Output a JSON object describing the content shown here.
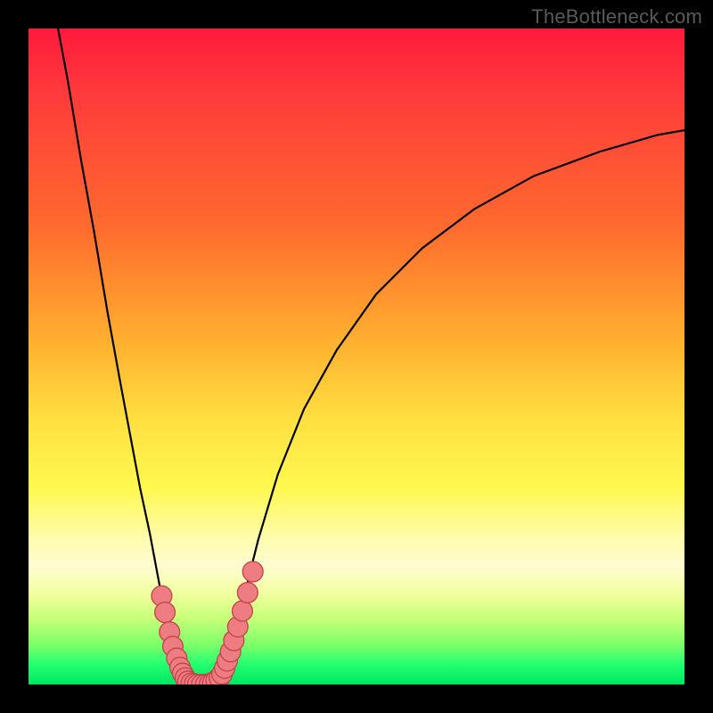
{
  "watermark": "TheBottleneck.com",
  "colors": {
    "curve_stroke": "#000000",
    "marker_fill": "#ee7d81",
    "marker_stroke": "#c1444b",
    "background_black": "#000000"
  },
  "chart_data": {
    "type": "line",
    "title": "",
    "xlabel": "",
    "ylabel": "",
    "xlim": [
      0,
      100
    ],
    "ylim": [
      0,
      100
    ],
    "grid": false,
    "series": [
      {
        "name": "left-branch",
        "x": [
          4.5,
          6.0,
          8.0,
          10.0,
          12.0,
          14.0,
          15.5,
          17.0,
          18.5,
          20.0,
          21.0,
          22.0,
          22.8,
          23.6,
          24.3
        ],
        "y": [
          100,
          92,
          80,
          69,
          57,
          46,
          38,
          30,
          23,
          15,
          10,
          6,
          3.5,
          1.2,
          0.0
        ]
      },
      {
        "name": "valley-floor",
        "x": [
          24.3,
          25.0,
          26.0,
          27.0,
          28.0,
          28.8
        ],
        "y": [
          0.0,
          0.0,
          0.0,
          0.0,
          0.0,
          0.0
        ]
      },
      {
        "name": "right-branch",
        "x": [
          28.8,
          29.6,
          30.5,
          31.5,
          33.0,
          35.0,
          38.0,
          42.0,
          47.0,
          53.0,
          60.0,
          68.0,
          77.0,
          87.0,
          96.0,
          100.0
        ],
        "y": [
          0.0,
          1.3,
          4.0,
          8.0,
          14.0,
          22.0,
          32.0,
          42.0,
          51.0,
          59.5,
          66.5,
          72.5,
          77.5,
          81.2,
          83.8,
          84.5
        ]
      }
    ],
    "markers": {
      "name": "highlighted-points",
      "x": [
        20.3,
        20.8,
        21.5,
        22.0,
        22.6,
        23.1,
        23.5,
        23.9,
        24.3,
        24.8,
        25.3,
        25.8,
        26.4,
        27.0,
        27.6,
        28.1,
        28.6,
        29.1,
        29.5,
        29.9,
        30.3,
        30.8,
        31.3,
        31.9,
        32.6,
        33.4,
        34.2
      ],
      "y": [
        13.5,
        11.0,
        8.0,
        5.8,
        4.0,
        2.6,
        1.7,
        1.0,
        0.5,
        0.2,
        0.1,
        0.0,
        0.0,
        0.0,
        0.1,
        0.3,
        0.6,
        1.0,
        1.6,
        2.5,
        3.6,
        5.0,
        6.7,
        8.8,
        11.2,
        14.0,
        17.2
      ],
      "r": 1.55
    }
  }
}
